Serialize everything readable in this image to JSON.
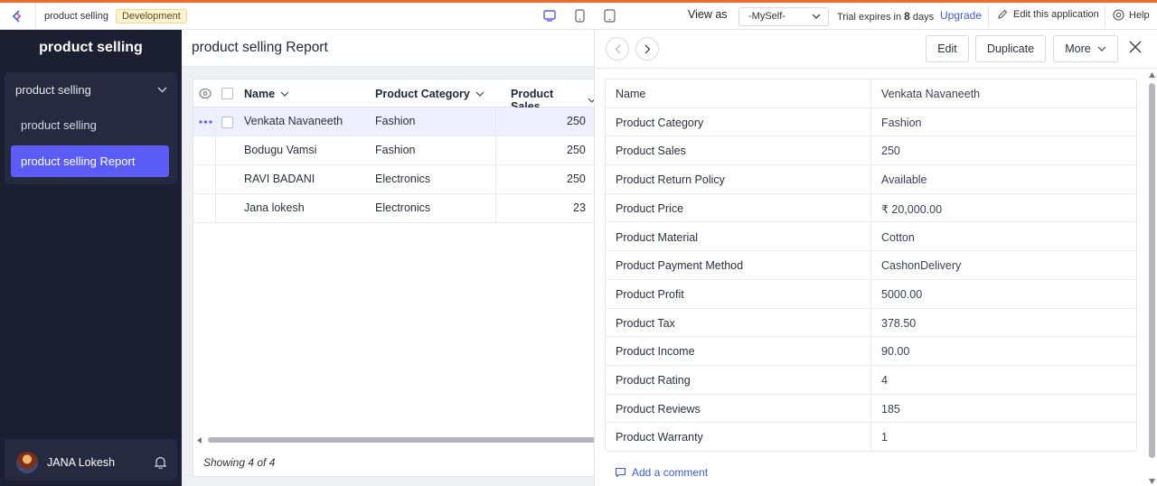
{
  "topbar": {
    "app_name": "product selling",
    "env_badge": "Development",
    "view_as_label": "View as",
    "view_as_value": "-MySelf-",
    "trial_prefix": "Trial expires in ",
    "trial_days": "8",
    "trial_suffix": " days",
    "upgrade_label": "Upgrade",
    "edit_app_label": "Edit this application",
    "help_label": "Help",
    "accent_color": "#f06a2a"
  },
  "sidebar": {
    "title": "product selling",
    "section_label": "product selling",
    "items": [
      {
        "label": "product selling"
      },
      {
        "label": "product selling Report"
      }
    ],
    "user_name": "JANA Lokesh",
    "active_color": "#5a5cf5"
  },
  "report": {
    "title": "product selling Report",
    "columns": [
      "Name",
      "Product Category",
      "Product Sales"
    ],
    "rows": [
      {
        "name": "Venkata Navaneeth",
        "category": "Fashion",
        "sales": "250"
      },
      {
        "name": "Bodugu Vamsi",
        "category": "Fashion",
        "sales": "250"
      },
      {
        "name": "RAVI BADANI",
        "category": "Electronics",
        "sales": "250"
      },
      {
        "name": "Jana lokesh",
        "category": "Electronics",
        "sales": "23"
      }
    ],
    "footer": "Showing 4 of 4"
  },
  "detail": {
    "edit_label": "Edit",
    "duplicate_label": "Duplicate",
    "more_label": "More",
    "fields": [
      {
        "label": "Name",
        "value": "Venkata Navaneeth"
      },
      {
        "label": "Product Category",
        "value": "Fashion"
      },
      {
        "label": "Product Sales",
        "value": "250"
      },
      {
        "label": "Product Return Policy",
        "value": "Available"
      },
      {
        "label": "Product Price",
        "value": "₹ 20,000.00"
      },
      {
        "label": "Product Material",
        "value": "Cotton"
      },
      {
        "label": "Product Payment Method",
        "value": "CashonDelivery"
      },
      {
        "label": "Product Profit",
        "value": "5000.00"
      },
      {
        "label": "Product Tax",
        "value": "378.50"
      },
      {
        "label": "Product Income",
        "value": "90.00"
      },
      {
        "label": "Product Rating",
        "value": "4"
      },
      {
        "label": "Product Reviews",
        "value": "185"
      },
      {
        "label": "Product Warranty",
        "value": "1"
      }
    ],
    "add_comment_label": "Add a comment"
  }
}
